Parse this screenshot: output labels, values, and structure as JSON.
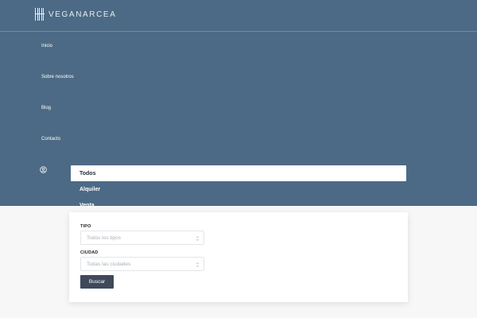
{
  "brand": {
    "name": "VEGANARCEA"
  },
  "nav": {
    "items": [
      {
        "label": "Inicio"
      },
      {
        "label": "Sobre nosotros"
      },
      {
        "label": "Blog"
      },
      {
        "label": "Contacto"
      }
    ],
    "user_icon": "user-circle-icon"
  },
  "search": {
    "tabs": [
      {
        "label": "Todos",
        "active": true
      },
      {
        "label": "Alquiler",
        "active": false
      },
      {
        "label": "Venta",
        "active": false
      }
    ],
    "fields": {
      "tipo": {
        "label": "TIPO",
        "value": "Todos los tipos"
      },
      "ciudad": {
        "label": "CIUDAD",
        "value": "Todas las ciudades"
      }
    },
    "submit_label": "Buscar"
  },
  "colors": {
    "header_bg": "#4c6a85",
    "button_bg": "#3f495a",
    "page_bg": "#f7f7f8"
  }
}
